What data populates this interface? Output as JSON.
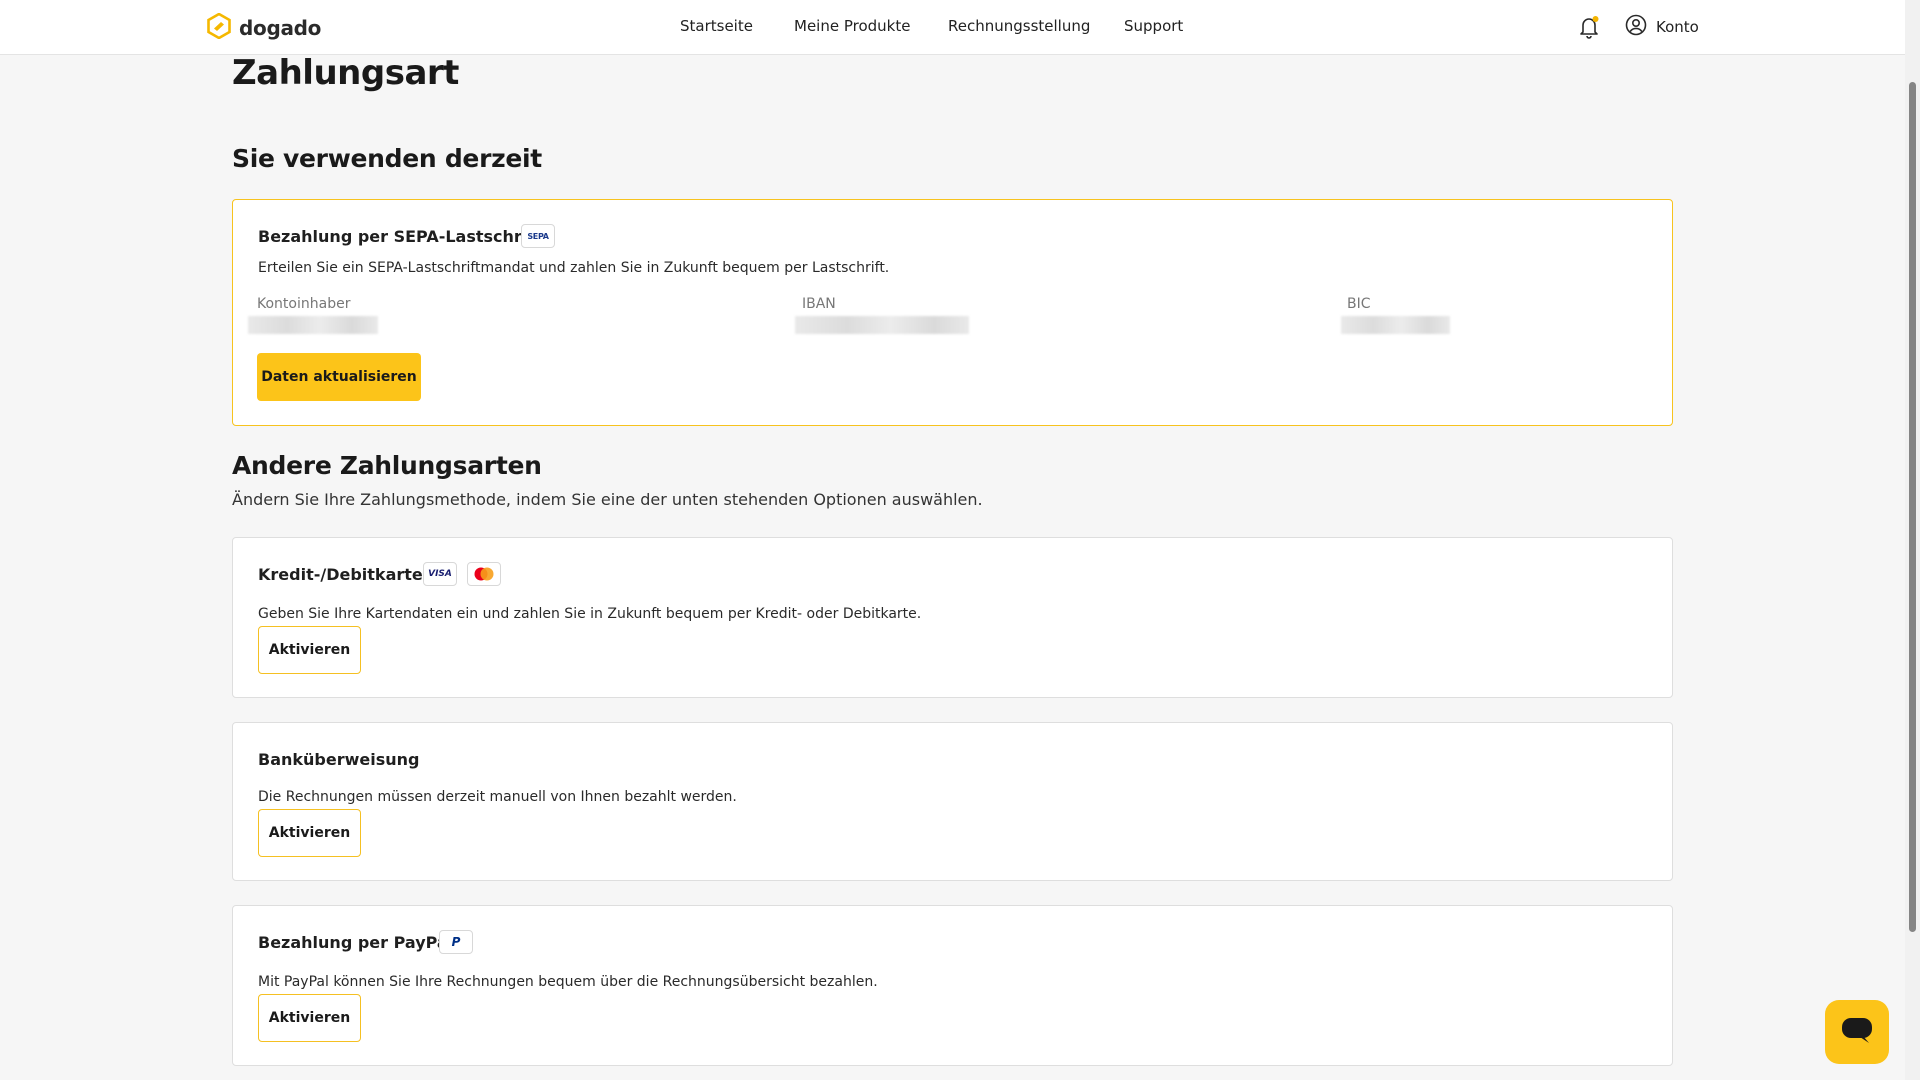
{
  "navbar": {
    "brand": "dogado",
    "links": [
      "Startseite",
      "Meine Produkte",
      "Rechnungsstellung",
      "Support"
    ],
    "account_label": "Konto"
  },
  "page": {
    "title": "Zahlungsart",
    "current_section_title": "Sie verwenden derzeit",
    "other_section_title": "Andere Zahlungsarten",
    "other_section_subtitle": "Ändern Sie Ihre Zahlungsmethode, indem Sie eine der unten stehenden Optionen auswählen."
  },
  "current_method": {
    "title": "Bezahlung per SEPA-Lastschrift",
    "badge": "SEPA",
    "description": "Erteilen Sie ein SEPA-Lastschriftmandat und zahlen Sie in Zukunft bequem per Lastschrift.",
    "fields": [
      {
        "label": "Kontoinhaber"
      },
      {
        "label": "IBAN"
      },
      {
        "label": "BIC"
      }
    ],
    "button_label": "Daten aktualisieren"
  },
  "other_methods": [
    {
      "title": "Kredit-/Debitkarte",
      "badges": [
        "VISA",
        "mastercard"
      ],
      "description": "Geben Sie Ihre Kartendaten ein und zahlen Sie in Zukunft bequem per Kredit- oder Debitkarte.",
      "button_label": "Aktivieren"
    },
    {
      "title": "Banküberweisung",
      "description": "Die Rechnungen müssen derzeit manuell von Ihnen bezahlt werden.",
      "button_label": "Aktivieren"
    },
    {
      "title": "Bezahlung per PayPal",
      "badges": [
        "P"
      ],
      "description": "Mit PayPal können Sie Ihre Rechnungen bequem über die Rechnungsübersicht bezahlen.",
      "button_label": "Aktivieren"
    }
  ],
  "colors": {
    "accent": "#fcc419",
    "accent_border": "#f5c022",
    "background": "#f6f6f6",
    "notification_dot": "#f4b400"
  },
  "icons": {
    "logo": "dogado-logo-icon",
    "notifications": "bell-icon",
    "account": "user-circle-icon",
    "chat": "chat-bubble-icon"
  }
}
